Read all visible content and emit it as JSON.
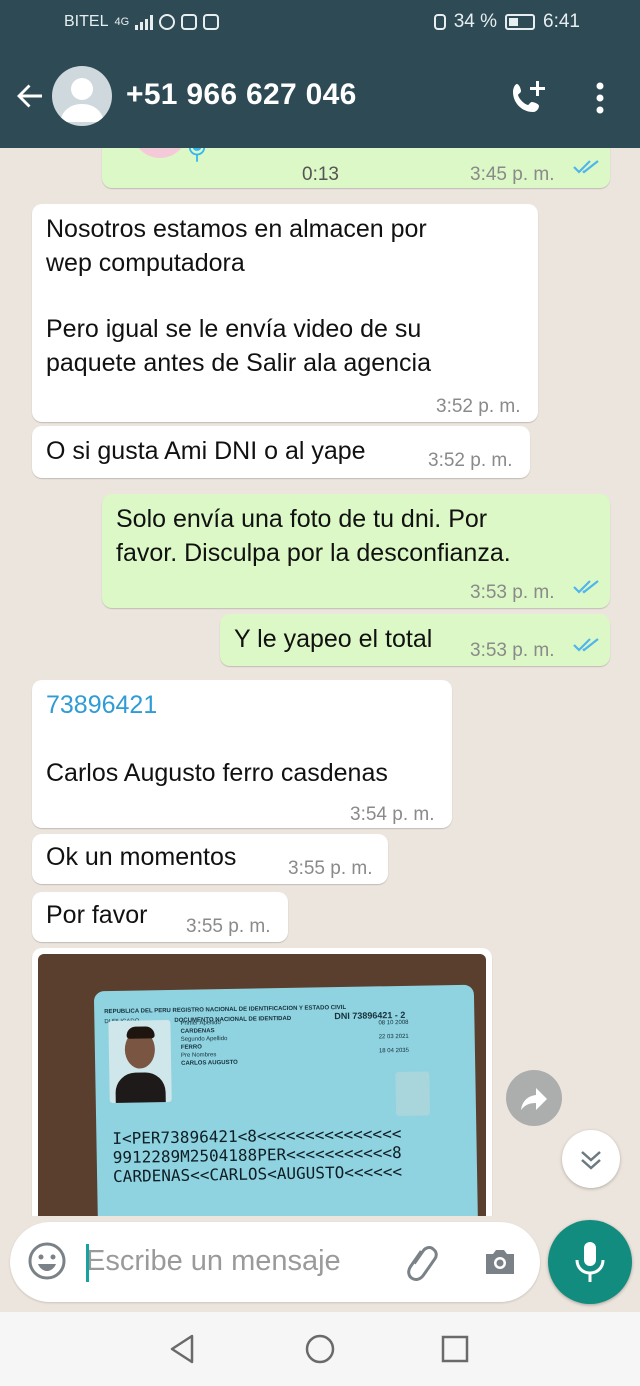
{
  "status_bar": {
    "carrier": "BITEL",
    "network": "4G",
    "battery": "34 %",
    "time": "6:41"
  },
  "header": {
    "contact": "+51 966 627 046",
    "icons": [
      "back-arrow-icon",
      "avatar",
      "add-call-icon",
      "more-vert-icon"
    ]
  },
  "messages": [
    {
      "dir": "out",
      "type": "voice",
      "duration": "0:13",
      "time": "3:45 p. m.",
      "read": true
    },
    {
      "dir": "in",
      "lines": [
        "Nosotros estamos en almacen por",
        "wep computadora",
        "",
        "Pero igual se le envía video de su",
        "paquete antes de Salir ala agencia"
      ],
      "time": "3:52 p. m."
    },
    {
      "dir": "in",
      "text": "O si gusta Ami DNI o al yape",
      "time": "3:52 p. m."
    },
    {
      "dir": "out",
      "lines": [
        "Solo envía una foto de tu dni. Por",
        "favor. Disculpa por la desconfianza."
      ],
      "time": "3:53 p. m.",
      "read": true
    },
    {
      "dir": "out",
      "text": "Y le yapeo el total",
      "time": "3:53 p. m.",
      "read": true
    },
    {
      "dir": "in",
      "link": "73896421",
      "text": "Carlos Augusto ferro casdenas",
      "time": "3:54 p. m."
    },
    {
      "dir": "in",
      "text": "Ok un momentos",
      "time": "3:55 p. m."
    },
    {
      "dir": "in",
      "text": "Por favor",
      "time": "3:55 p. m."
    },
    {
      "dir": "in",
      "type": "image",
      "card": {
        "header": "REPUBLICA DEL PERU REGISTRO NACIONAL DE IDENTIFICACION Y ESTADO CIVIL",
        "doc": "DOCUMENTO NACIONAL DE IDENTIDAD",
        "dup": "DUPLICADO",
        "dni": "DNI 73896421 - 2",
        "name_block": [
          "Primer Apellido",
          "CARDENAS",
          "Segundo Apellido",
          "FERRO",
          "Pre Nombres",
          "CARLOS AUGUSTO"
        ],
        "dates": [
          "08 10 2008",
          "22 03 2021",
          "18 04 2035"
        ],
        "mrz": [
          "I<PER73896421<8<<<<<<<<<<<<<<<",
          "9912289M2504188PER<<<<<<<<<<<8",
          "CARDENAS<<CARLOS<AUGUSTO<<<<<<"
        ]
      }
    }
  ],
  "composer": {
    "placeholder": "Escribe un mensaje"
  },
  "colors": {
    "header": "#2d4a55",
    "outgoing": "#dcf8c6",
    "incoming": "#ffffff",
    "link": "#2f9cd6",
    "ticks": "#4fb6ec",
    "mic": "#128c7e"
  }
}
